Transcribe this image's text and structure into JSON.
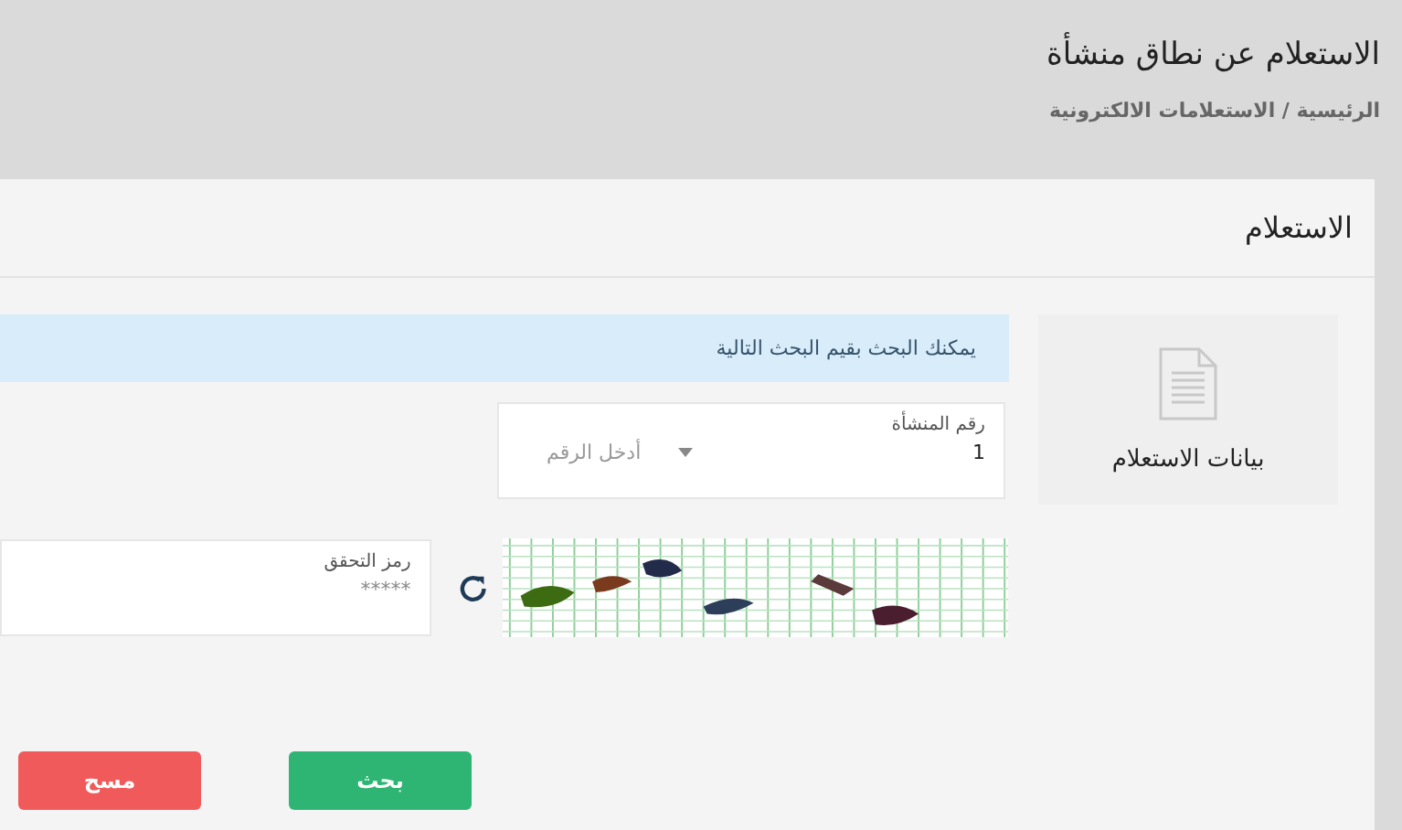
{
  "page": {
    "title": "الاستعلام عن نطاق منشأة",
    "breadcrumb": "الرئيسية / الاستعلامات الالكترونية"
  },
  "card": {
    "title": "الاستعلام"
  },
  "sidebar": {
    "label": "بيانات الاستعلام"
  },
  "alert": "يمكنك البحث بقيم البحث التالية",
  "facility_field": {
    "label": "رقم المنشأة",
    "value": "1",
    "placeholder": "أدخل الرقم"
  },
  "captcha": {
    "kind": "picture",
    "label": "رمز التحقق",
    "placeholder": "*****"
  },
  "buttons": [
    {
      "label": "بحث",
      "kind": "primary"
    },
    {
      "label": "مسح",
      "kind": "danger"
    }
  ]
}
